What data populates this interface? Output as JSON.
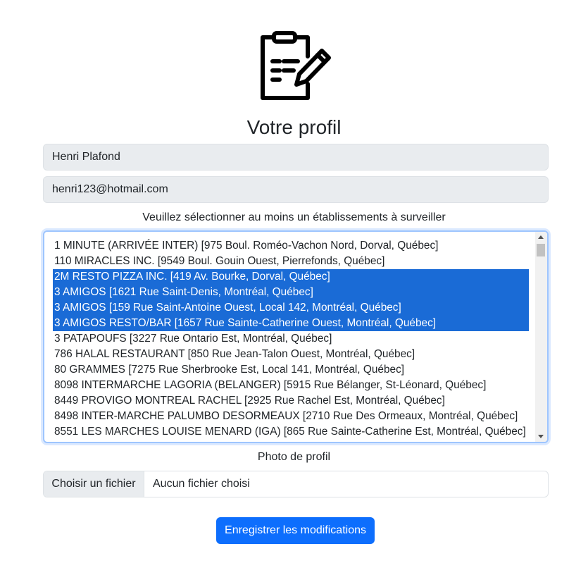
{
  "profile": {
    "title": "Votre profil",
    "name_value": "Henri Plafond",
    "email_value": "henri123@hotmail.com",
    "select_label": "Veuillez sélectionner au moins un établissements à surveiller",
    "establishments": [
      {
        "label": "1 MINUTE (ARRIVÉE INTER) [975 Boul. Roméo-Vachon Nord, Dorval, Québec]",
        "selected": false
      },
      {
        "label": "110 MIRACLES INC. [9549 Boul. Gouin Ouest, Pierrefonds, Québec]",
        "selected": false
      },
      {
        "label": "2M RESTO PIZZA INC. [419 Av. Bourke, Dorval, Québec]",
        "selected": true
      },
      {
        "label": "3 AMIGOS [1621 Rue Saint-Denis, Montréal, Québec]",
        "selected": true
      },
      {
        "label": "3 AMIGOS [159 Rue Saint-Antoine Ouest, Local 142, Montréal, Québec]",
        "selected": true
      },
      {
        "label": "3 AMIGOS RESTO/BAR [1657 Rue Sainte-Catherine Ouest, Montréal, Québec]",
        "selected": true
      },
      {
        "label": "3 PATAPOUFS [3227 Rue Ontario Est, Montréal, Québec]",
        "selected": false
      },
      {
        "label": "786 HALAL RESTAURANT [850 Rue Jean-Talon Ouest, Montréal, Québec]",
        "selected": false
      },
      {
        "label": "80 GRAMMES [7275 Rue Sherbrooke Est, Local 141, Montréal, Québec]",
        "selected": false
      },
      {
        "label": "8098 INTERMARCHE LAGORIA (BELANGER) [5915 Rue Bélanger, St-Léonard, Québec]",
        "selected": false
      },
      {
        "label": "8449 PROVIGO MONTREAL RACHEL [2925 Rue Rachel Est, Montréal, Québec]",
        "selected": false
      },
      {
        "label": "8498 INTER-MARCHE PALUMBO DESORMEAUX [2710 Rue Des Ormeaux, Montréal, Québec]",
        "selected": false
      },
      {
        "label": "8551 LES MARCHES LOUISE MENARD (IGA) [865 Rue Sainte-Catherine Est, Montréal, Québec]",
        "selected": false
      }
    ],
    "photo_label": "Photo de profil",
    "file_button_label": "Choisir un fichier",
    "file_status": "Aucun fichier choisi",
    "submit_label": "Enregistrer les modifications"
  },
  "icons": {
    "logo": "clipboard-edit-icon"
  },
  "colors": {
    "primary": "#0d6efd",
    "selection": "#1a6bd6",
    "field_bg": "#e9ecef"
  }
}
